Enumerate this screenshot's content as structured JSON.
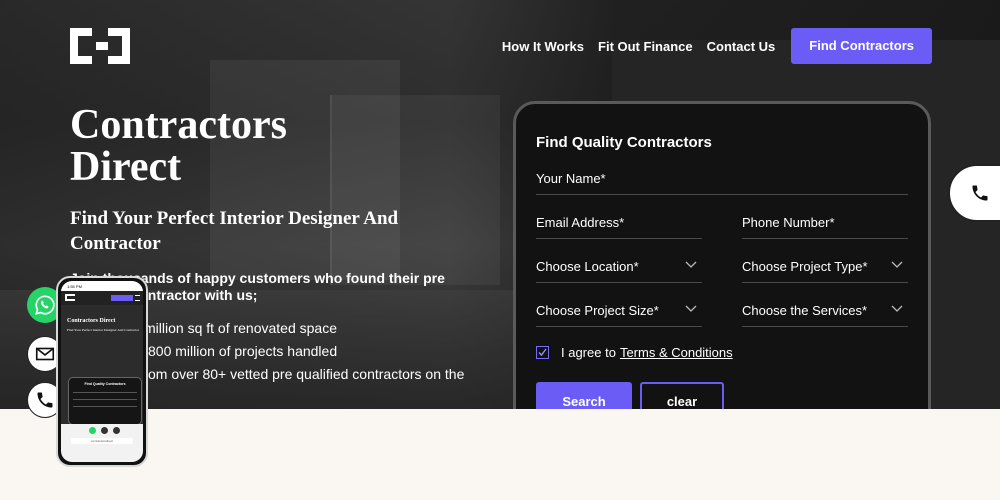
{
  "nav": {
    "links": [
      "How It Works",
      "Fit Out Finance",
      "Contact Us"
    ],
    "cta": "Find Contractors"
  },
  "hero": {
    "title": "Contractors Direct",
    "subtitle": "Find Your Perfect Interior Designer And Contractor",
    "intro": "Join thousands of happy customers who found their pre qualified contractor with us;",
    "stats": [
      "million sq ft of renovated space",
      "800 million of projects handled",
      "om over 80+ vetted pre qualified contractors on the"
    ]
  },
  "form": {
    "title": "Find Quality Contractors",
    "name_label": "Your Name*",
    "email_label": "Email Address*",
    "phone_label": "Phone Number*",
    "location_label": "Choose Location*",
    "project_type_label": "Choose Project Type*",
    "project_size_label": "Choose Project Size*",
    "services_label": "Choose the Services*",
    "agree_text": "I agree to",
    "terms_link": "Terms & Conditions",
    "search_button": "Search",
    "clear_button": "clear"
  },
  "mockup": {
    "status_time": "1:55 PM",
    "title": "Contractors Direct",
    "subtitle": "Find Your Perfect Interior Designer And Contractor",
    "card_title": "Find Quality Contractors",
    "url": "contractorsdirect"
  },
  "colors": {
    "accent": "#6b5cf6",
    "whatsapp": "#25d366",
    "page_bg": "#faf6f1"
  }
}
